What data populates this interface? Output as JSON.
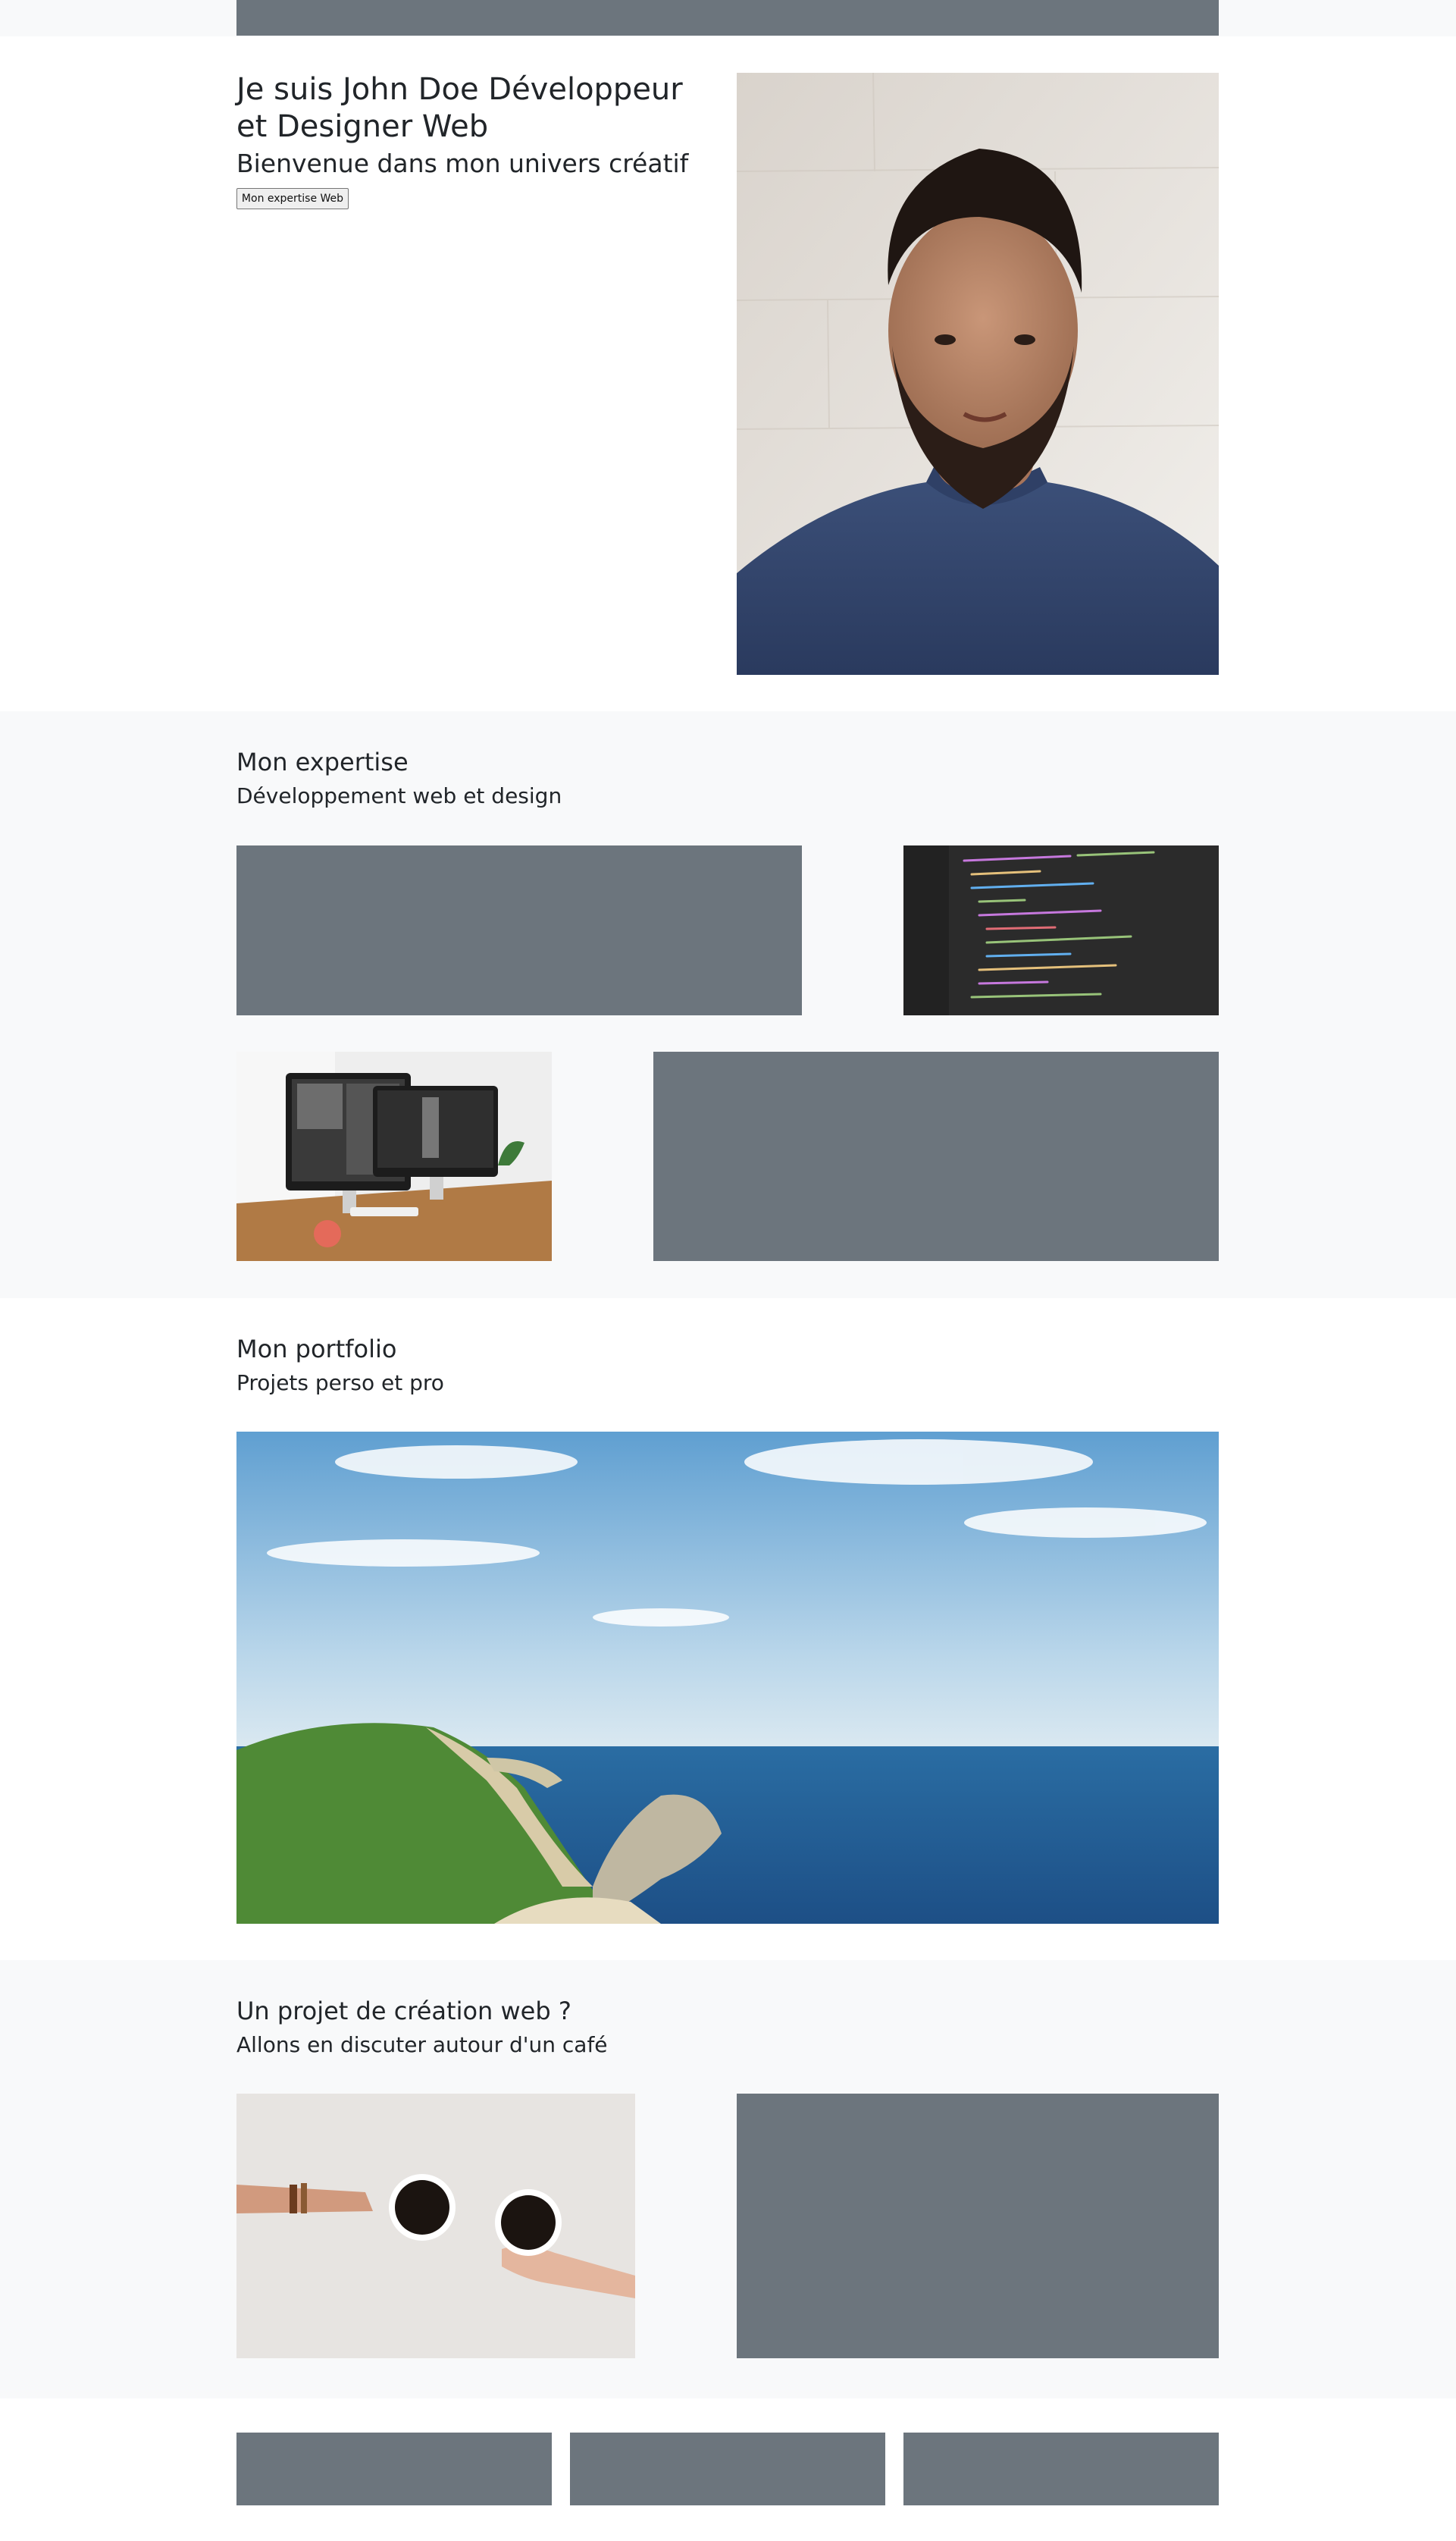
{
  "colors": {
    "placeholder_block": "#6c757d",
    "section_alt_background": "#f8f9fa",
    "page_background": "#ffffff",
    "text": "#212529"
  },
  "hero": {
    "title": "Je suis John Doe Développeur et Designer Web",
    "subtitle": "Bienvenue dans mon univers créatif",
    "button_label": "Mon expertise Web",
    "image_icon": "portrait-photo"
  },
  "expertise": {
    "title": "Mon expertise",
    "subtitle": "Développement web et design",
    "images": [
      "code-editor-photo",
      "desk-computers-photo"
    ]
  },
  "portfolio": {
    "title": "Mon portfolio",
    "subtitle": "Projets perso et pro",
    "image_icon": "coastline-landscape-photo"
  },
  "contact": {
    "title": "Un projet de création web ?",
    "subtitle": "Allons en discuter autour d'un café",
    "image_icon": "coffee-cups-photo"
  }
}
